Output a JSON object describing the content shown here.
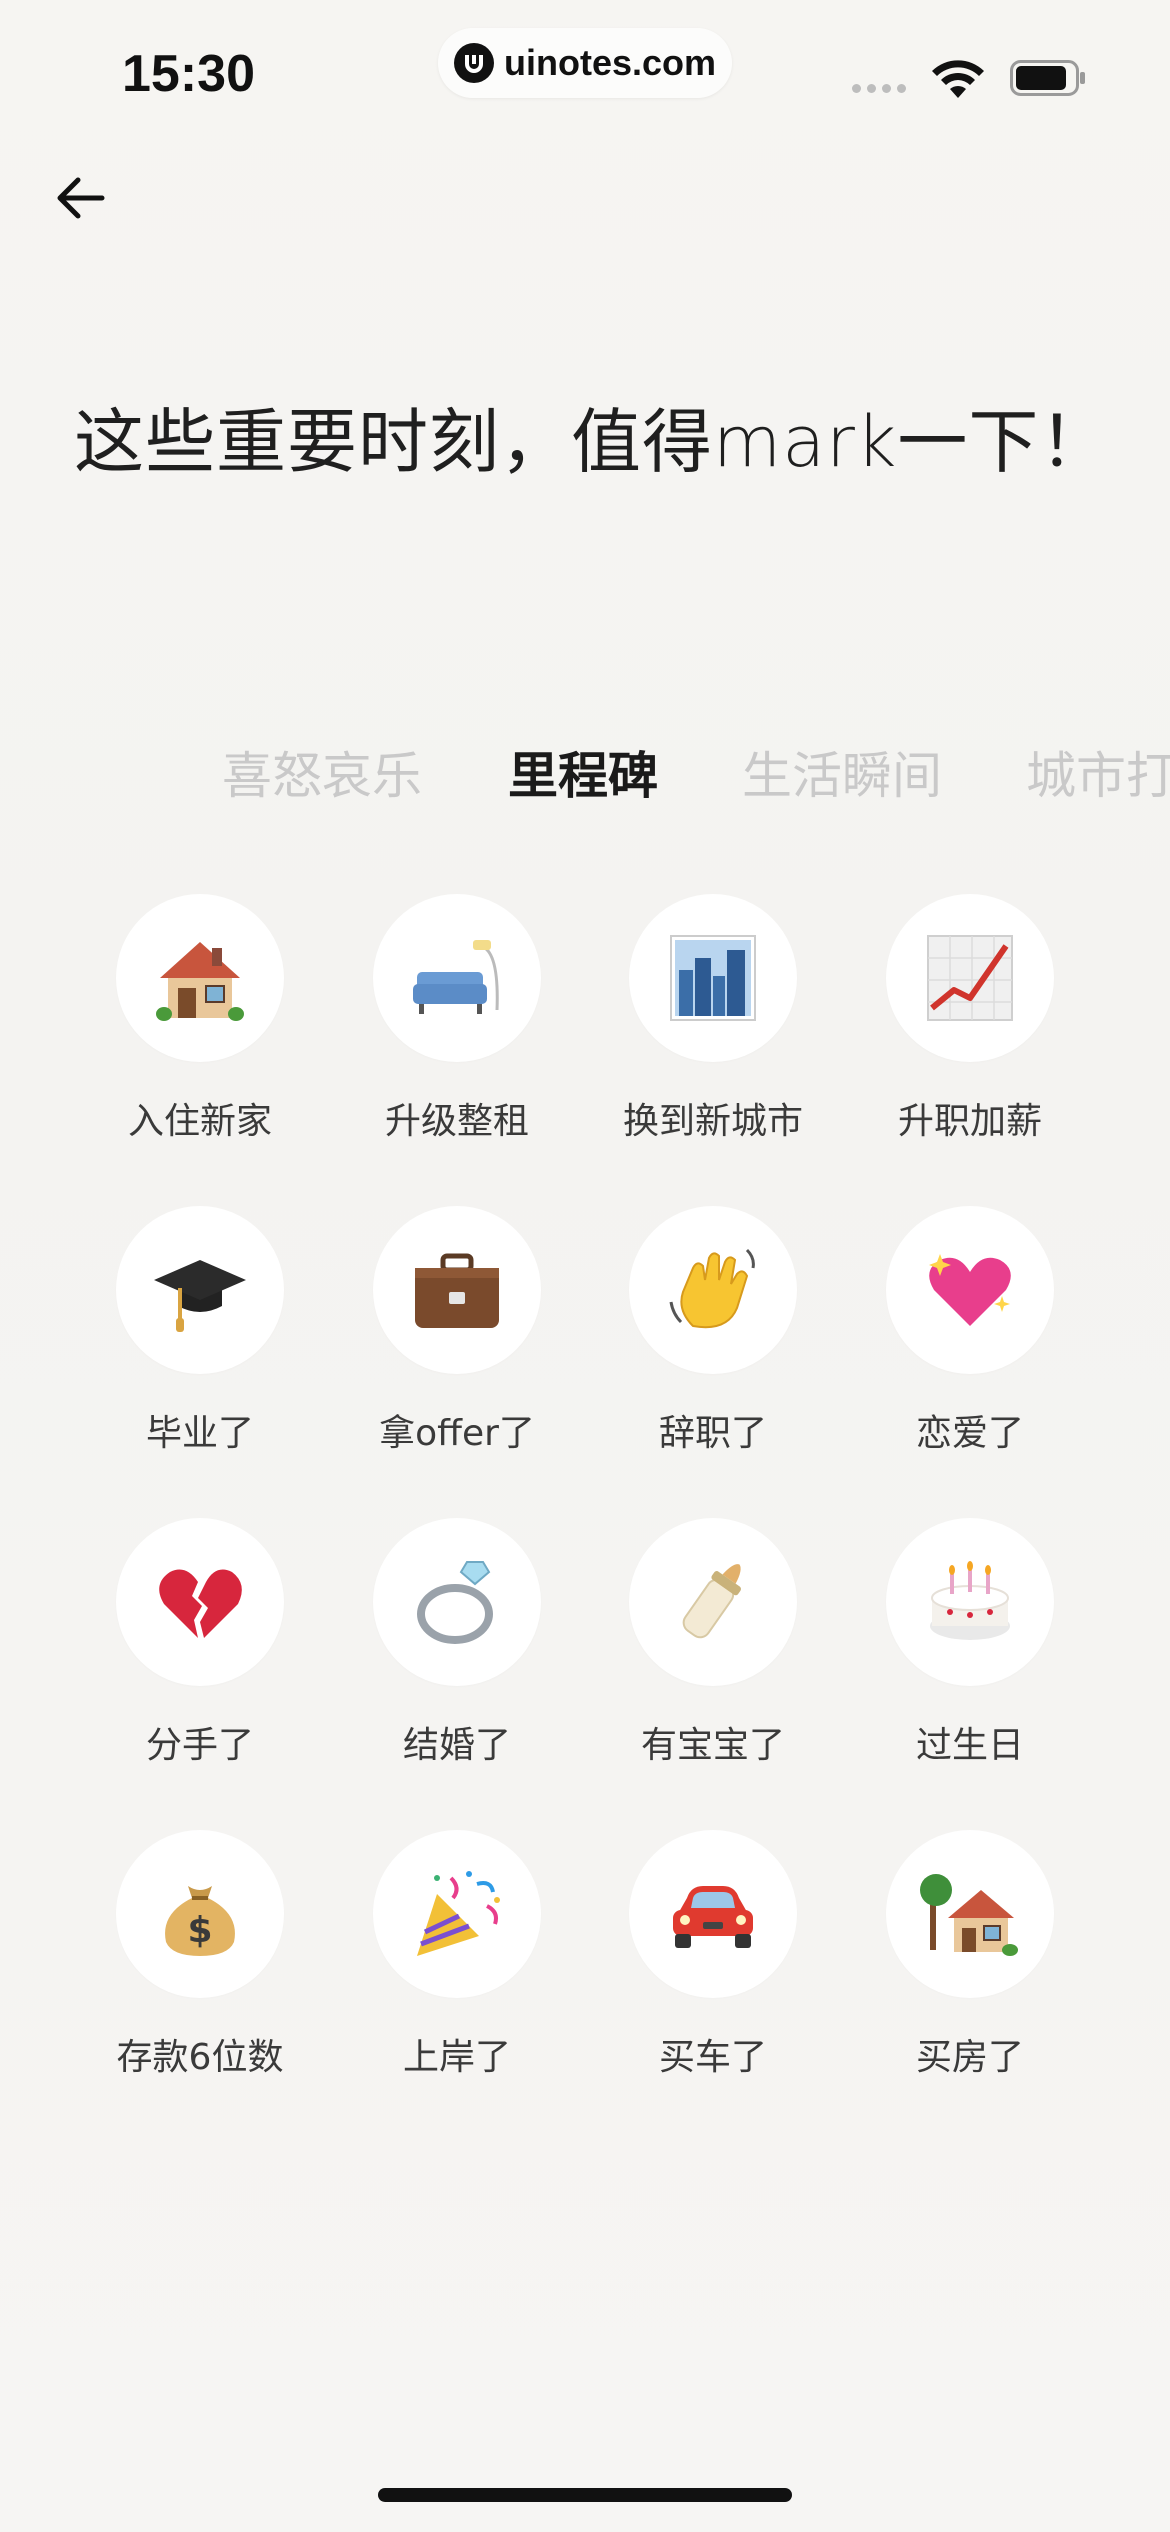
{
  "status_bar": {
    "time": "15:30",
    "url": "uinotes.com"
  },
  "header": {
    "headline": "这些重要时刻，值得mark一下！"
  },
  "tabs": [
    {
      "label": "喜怒哀乐"
    },
    {
      "label": "里程碑"
    },
    {
      "label": "生活瞬间"
    },
    {
      "label": "城市打"
    }
  ],
  "items": [
    {
      "label": "入住新家",
      "icon": "house-icon"
    },
    {
      "label": "升级整租",
      "icon": "couch-lamp-icon"
    },
    {
      "label": "换到新城市",
      "icon": "cityscape-icon"
    },
    {
      "label": "升职加薪",
      "icon": "chart-increasing-icon"
    },
    {
      "label": "毕业了",
      "icon": "graduation-cap-icon"
    },
    {
      "label": "拿offer了",
      "icon": "briefcase-icon"
    },
    {
      "label": "辞职了",
      "icon": "waving-hand-icon"
    },
    {
      "label": "恋爱了",
      "icon": "sparkling-heart-icon"
    },
    {
      "label": "分手了",
      "icon": "broken-heart-icon"
    },
    {
      "label": "结婚了",
      "icon": "ring-icon"
    },
    {
      "label": "有宝宝了",
      "icon": "baby-bottle-icon"
    },
    {
      "label": "过生日",
      "icon": "birthday-cake-icon"
    },
    {
      "label": "存款6位数",
      "icon": "money-bag-icon"
    },
    {
      "label": "上岸了",
      "icon": "party-popper-icon"
    },
    {
      "label": "买车了",
      "icon": "car-icon"
    },
    {
      "label": "买房了",
      "icon": "house-with-garden-icon"
    }
  ],
  "colors": {
    "active_tab": "#1a1a1a",
    "inactive_tab": "#c9c9c9",
    "background": "#f5f4f1"
  }
}
